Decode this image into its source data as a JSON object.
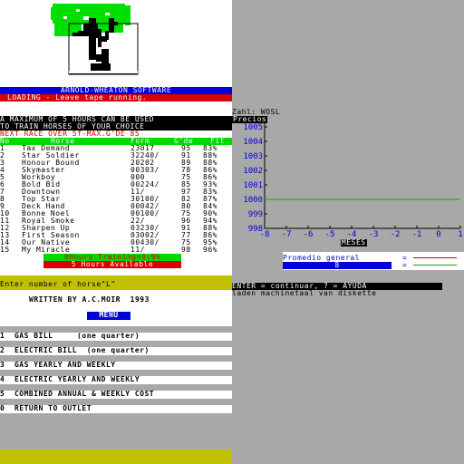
{
  "publisher": {
    "title": "ARNOLD-WHEATON SOFTWARE",
    "status": "LOADING - Leave tape running."
  },
  "horse_game": {
    "notice_line1": "A MAXIMUM OF 5 HOURS CAN BE USED",
    "notice_line2": "TO TRAIN HORSES OF YOUR CHOICE",
    "next_race": "NEXT RACE OVER 5f-MAX.G'DE 85",
    "columns": [
      "No",
      "Horse",
      "Form",
      "G'de",
      "Fit"
    ],
    "horses": [
      {
        "no": "1",
        "name": "Tax Demand",
        "form": "23017",
        "grade": "95",
        "fit": "83%"
      },
      {
        "no": "2",
        "name": "Star Soldier",
        "form": "32240/",
        "grade": "91",
        "fit": "88%"
      },
      {
        "no": "3",
        "name": "Honour Bound",
        "form": "20202",
        "grade": "89",
        "fit": "88%"
      },
      {
        "no": "4",
        "name": "Skymaster",
        "form": "00303/",
        "grade": "78",
        "fit": "86%"
      },
      {
        "no": "5",
        "name": "Workboy",
        "form": "000",
        "grade": "75",
        "fit": "86%"
      },
      {
        "no": "6",
        "name": "Bold Bid",
        "form": "00224/",
        "grade": "85",
        "fit": "93%"
      },
      {
        "no": "7",
        "name": "Downtown",
        "form": "11/",
        "grade": "97",
        "fit": "83%"
      },
      {
        "no": "8",
        "name": "Top Star",
        "form": "30100/",
        "grade": "82",
        "fit": "87%"
      },
      {
        "no": "9",
        "name": "Deck Hand",
        "form": "00042/",
        "grade": "80",
        "fit": "84%"
      },
      {
        "no": "10",
        "name": "Bonne Noel",
        "form": "00100/",
        "grade": "75",
        "fit": "90%"
      },
      {
        "no": "11",
        "name": "Royal Smoke",
        "form": "22/",
        "grade": "96",
        "fit": "94%"
      },
      {
        "no": "12",
        "name": "Sharpen Up",
        "form": "03230/",
        "grade": "91",
        "fit": "88%"
      },
      {
        "no": "13",
        "name": "First Season",
        "form": "03002/",
        "grade": "77",
        "fit": "86%"
      },
      {
        "no": "14",
        "name": "Our Native",
        "form": "00430/",
        "grade": "75",
        "fit": "95%"
      },
      {
        "no": "15",
        "name": "My Miracle",
        "form": "11/",
        "grade": "98",
        "fit": "96%"
      }
    ],
    "hours_training": "0Hours Training=4:9%",
    "hours_available": "5 Hours Available",
    "prompt": "Enter number of horse\"L\""
  },
  "bills_menu": {
    "author": "WRITTEN BY A.C.MOIR  1993",
    "menu_title": "MENU",
    "items": [
      "1  GAS BILL     (one quarter)",
      "2  ELECTRIC BILL  (one quarter)",
      "3  GAS YEARLY AND WEEKLY",
      "4  ELECTRIC YEARLY AND WEEKLY",
      "5  COMBINED ANNUAL & WEEKLY COST",
      "0  RETURN TO OUTLET"
    ]
  },
  "price_chart": {
    "header": "Zahl: WOSL",
    "precios_label": "Precios",
    "legend_label": "Promedio general",
    "legend_value": "8",
    "continue_prompt": "ENTER = continuar, ? = AYUDA",
    "loading_msg": "laden machinetaal van diskette",
    "colors": {
      "axis": "#000000",
      "ticks": "#0000d8",
      "line": "#00b000",
      "accent_red": "#d80000"
    }
  },
  "chart_data": {
    "type": "line",
    "title": "",
    "xlabel": "MESES",
    "ylabel": "Precios",
    "x_ticks": [
      "-8",
      "-7",
      "-6",
      "-5",
      "-4",
      "-3",
      "-2",
      "-1",
      "0",
      "1"
    ],
    "y_ticks": [
      "1005",
      "1004",
      "1003",
      "1002",
      "1001",
      "1000",
      "999",
      "998"
    ],
    "xlim": [
      -8,
      1
    ],
    "ylim": [
      998,
      1005
    ],
    "series": [
      {
        "name": "Promedio general",
        "x": [
          -8,
          1
        ],
        "values": [
          1000,
          1000
        ]
      }
    ]
  }
}
